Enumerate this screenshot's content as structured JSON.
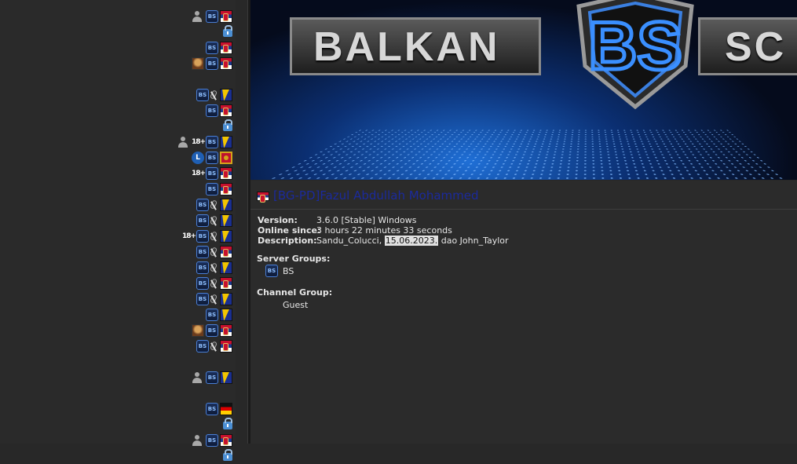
{
  "tree": {
    "rows": [
      {
        "icons": [
          "user-icon",
          "bs-group-icon",
          "serbia-flag-icon"
        ]
      },
      {
        "icons": [
          "lock-icon"
        ]
      },
      {
        "icons": [
          "bs-group-icon",
          "serbia-flag-icon"
        ]
      },
      {
        "icons": [
          "avatar-icon",
          "bs-group-icon",
          "serbia-flag-icon"
        ]
      },
      {
        "icons": []
      },
      {
        "icons": [
          "bs-group-icon",
          "muted-mic-icon",
          "bosnia-flag-icon"
        ]
      },
      {
        "icons": [
          "bs-group-icon",
          "serbia-flag-icon"
        ]
      },
      {
        "icons": [
          "lock-icon"
        ]
      },
      {
        "icons": [
          "user-icon",
          "age-18-icon",
          "bs-group-icon",
          "bosnia-flag-icon"
        ]
      },
      {
        "icons": [
          "l-badge-icon",
          "bs-group-icon",
          "montenegro-flag-icon"
        ]
      },
      {
        "icons": [
          "age-18-icon",
          "bs-group-icon",
          "serbia-flag-icon"
        ]
      },
      {
        "icons": [
          "bs-group-icon",
          "serbia-flag-icon"
        ]
      },
      {
        "icons": [
          "bs-group-icon",
          "muted-mic-icon",
          "bosnia-flag-icon"
        ]
      },
      {
        "icons": [
          "bs-group-icon",
          "muted-mic-icon",
          "bosnia-flag-icon"
        ]
      },
      {
        "icons": [
          "age-18-icon",
          "bs-group-icon",
          "muted-mic-icon",
          "bosnia-flag-icon"
        ]
      },
      {
        "icons": [
          "bs-group-icon",
          "muted-mic-icon",
          "serbia-flag-icon"
        ]
      },
      {
        "icons": [
          "bs-group-icon",
          "muted-mic-icon",
          "bosnia-flag-icon"
        ]
      },
      {
        "icons": [
          "bs-group-icon",
          "muted-mic-icon",
          "serbia-flag-icon"
        ]
      },
      {
        "icons": [
          "bs-group-icon",
          "muted-mic-icon",
          "bosnia-flag-icon"
        ]
      },
      {
        "icons": [
          "bs-group-icon",
          "bosnia-flag-icon"
        ]
      },
      {
        "icons": [
          "avatar-icon",
          "bs-group-icon",
          "serbia-flag-icon"
        ]
      },
      {
        "icons": [
          "bs-group-icon",
          "muted-mic-icon",
          "serbia-flag-icon"
        ]
      },
      {
        "icons": []
      },
      {
        "icons": [
          "user-icon",
          "bs-group-icon",
          "bosnia-flag-icon"
        ]
      },
      {
        "icons": []
      },
      {
        "icons": [
          "bs-group-icon",
          "germany-flag-icon"
        ]
      },
      {
        "icons": [
          "lock-icon"
        ]
      },
      {
        "icons": [
          "user-icon",
          "bs-group-icon",
          "serbia-flag-icon"
        ]
      },
      {
        "icons": [
          "lock-icon"
        ]
      }
    ]
  },
  "banner": {
    "left_text": "BALKAN",
    "right_text": "SC",
    "logo_text": "BS"
  },
  "client": {
    "flag": "serbia-flag-icon",
    "name": "[BG-PD]Fazul Abdullah Mohammed",
    "version_label": "Version:",
    "version": "3.6.0 [Stable] Windows",
    "online_label": "Online since:",
    "online": "3 hours 22 minutes 33 seconds",
    "description_label": "Description:",
    "description_prefix": "Sandu_Colucci, ",
    "description_date": "15.06.2023.",
    "description_suffix": " dao John_Taylor",
    "server_groups_label": "Server Groups:",
    "server_group_icon": "bs-group-icon",
    "server_group": "BS",
    "channel_group_label": "Channel Group:",
    "channel_group": "Guest"
  },
  "colors": {
    "panel_bg": "#2b2b2b",
    "tree_bg": "#2a2a2a",
    "client_name": "#1b2a9c",
    "banner_blue": "#1f6fd6"
  }
}
